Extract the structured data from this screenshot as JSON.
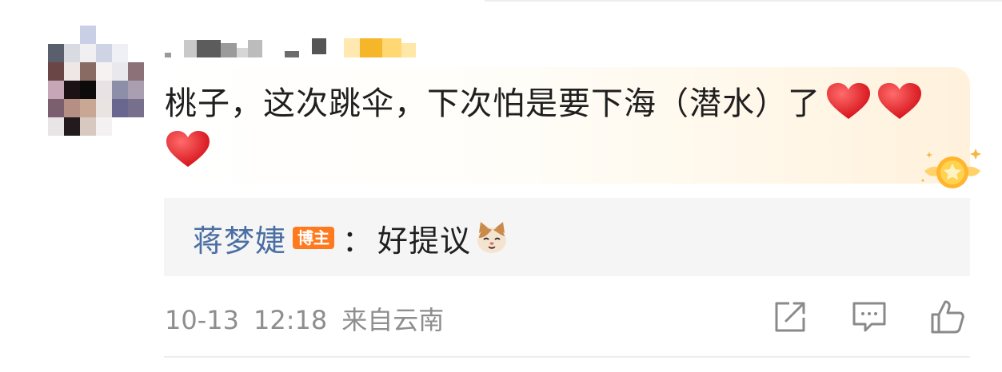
{
  "comment": {
    "text": "桃子，这次跳伞，下次怕是要下海（潜水）了",
    "emoji_count": 3,
    "emoji": "red-heart-icon"
  },
  "reply": {
    "author": "蒋梦婕",
    "role_badge": "博主",
    "separator": "：",
    "text": "好提议",
    "emoji": "cat-face-icon"
  },
  "meta": {
    "date": "10-13",
    "time": "12:18",
    "location": "来自云南"
  },
  "actions": {
    "share": "share-icon",
    "comment": "comment-icon",
    "like": "thumbs-up-icon"
  },
  "colors": {
    "author_link": "#4b6fa3",
    "role_badge_bg": "#ff7a1f",
    "meta_text": "#8e8e8e",
    "reply_bg": "#f5f5f5",
    "heart": "#e8262a"
  }
}
